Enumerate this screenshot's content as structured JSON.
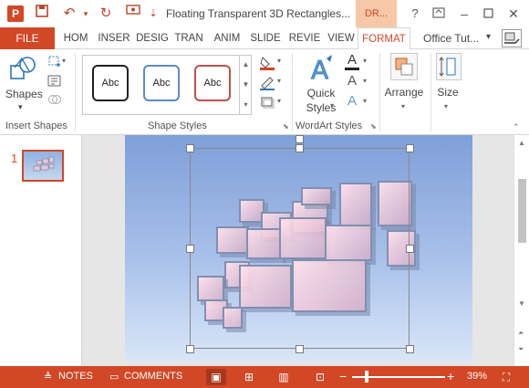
{
  "titlebar": {
    "app_icon_letter": "P",
    "title": "Floating Transparent 3D Rectangles...",
    "context_tab_header": "DR...",
    "icons": [
      "save-icon",
      "undo-icon",
      "redo-icon",
      "presenter-icon",
      "customize-qat-icon",
      "help-icon",
      "ribbon-display-icon",
      "minimize-icon",
      "maximize-icon",
      "close-icon"
    ]
  },
  "tabs": {
    "file": "FILE",
    "items": [
      "HOM",
      "INSER",
      "DESIG",
      "TRAN",
      "ANIM",
      "SLIDE",
      "REVIE",
      "VIEW",
      "FORMAT"
    ],
    "active": "FORMAT",
    "user": "Office Tut..."
  },
  "ribbon": {
    "shapes_label": "Shapes",
    "insert_shapes_group": "Insert Shapes",
    "style_swatches": [
      "Abc",
      "Abc",
      "Abc"
    ],
    "swatch_colors": [
      "#222222",
      "#5b8bc9",
      "#c0504d"
    ],
    "shape_styles_group": "Shape Styles",
    "quick_styles_label": "Quick Styles",
    "wordart_letter": "A",
    "wordart_group": "WordArt Styles",
    "arrange_label": "Arrange",
    "size_label": "Size"
  },
  "thumbnails": {
    "slide_number": "1"
  },
  "statusbar": {
    "notes": "NOTES",
    "comments": "COMMENTS",
    "zoom_minus": "−",
    "zoom_plus": "+",
    "zoom_percent": "39%",
    "zoom_level": 0.39
  },
  "colors": {
    "accent": "#d24726",
    "slide_top": "#7f9fd8",
    "slide_bottom": "#d9e6f7"
  }
}
